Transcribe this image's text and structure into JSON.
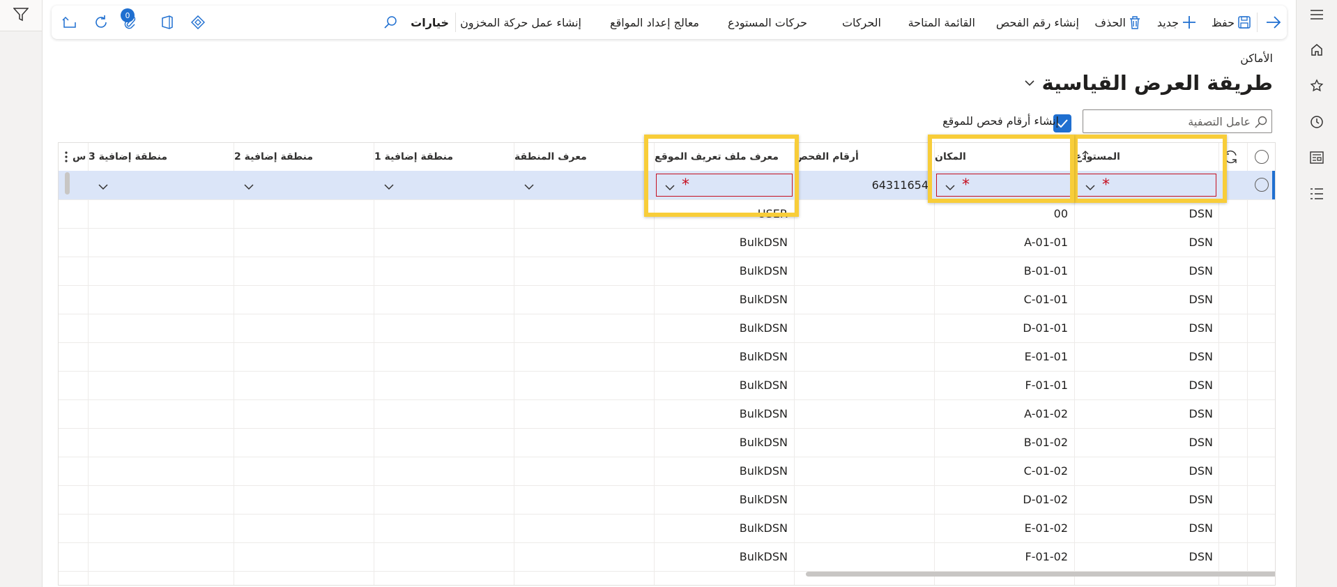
{
  "toolbar": {
    "save_label": "حفظ",
    "new_label": "جديد",
    "delete_label": "الحذف",
    "create_check_digits_label": "إنشاء رقم الفحص",
    "available_list_label": "القائمة المتاحة",
    "transactions_label": "الحركات",
    "warehouse_transactions_label": "حركات المستودع",
    "location_setup_wizard_label": "معالج إعداد المواقع",
    "create_inventory_movement_label": "إنشاء عمل حركة المخزون",
    "options_label": "خيارات",
    "attachments_count": "0"
  },
  "page": {
    "breadcrumb": "الأماكن",
    "view_title": "طريقة العرض القياسية"
  },
  "filter": {
    "placeholder": "عامل التصفية",
    "create_check_digits_checkbox_label": "إنشاء أرقام فحص للموقع",
    "create_check_digits_checked": true
  },
  "grid": {
    "columns": {
      "warehouse": "المستودع",
      "location": "المكان",
      "check_digits": "أرقام الفحص",
      "location_profile": "معرف ملف تعريف الموقع",
      "zone": "معرف المنطقة",
      "extra_zone_1": "منطقة إضافية 1",
      "extra_zone_2": "منطقة إضافية 2",
      "extra_zone_3": "منطقة إضافية 3",
      "overflow": "س"
    },
    "new_row": {
      "check_digits": "64311654"
    },
    "rows": [
      {
        "warehouse": "DSN",
        "location": "00",
        "profile": "USER"
      },
      {
        "warehouse": "DSN",
        "location": "A-01-01",
        "profile": "BulkDSN"
      },
      {
        "warehouse": "DSN",
        "location": "B-01-01",
        "profile": "BulkDSN"
      },
      {
        "warehouse": "DSN",
        "location": "C-01-01",
        "profile": "BulkDSN"
      },
      {
        "warehouse": "DSN",
        "location": "D-01-01",
        "profile": "BulkDSN"
      },
      {
        "warehouse": "DSN",
        "location": "E-01-01",
        "profile": "BulkDSN"
      },
      {
        "warehouse": "DSN",
        "location": "F-01-01",
        "profile": "BulkDSN"
      },
      {
        "warehouse": "DSN",
        "location": "A-01-02",
        "profile": "BulkDSN"
      },
      {
        "warehouse": "DSN",
        "location": "B-01-02",
        "profile": "BulkDSN"
      },
      {
        "warehouse": "DSN",
        "location": "C-01-02",
        "profile": "BulkDSN"
      },
      {
        "warehouse": "DSN",
        "location": "D-01-02",
        "profile": "BulkDSN"
      },
      {
        "warehouse": "DSN",
        "location": "E-01-02",
        "profile": "BulkDSN"
      },
      {
        "warehouse": "DSN",
        "location": "F-01-02",
        "profile": "BulkDSN"
      }
    ]
  },
  "colors": {
    "accent": "#1f6fd0",
    "selected_row": "#dbe5f8",
    "required": "#c50f1f",
    "highlight": "#f8cd39"
  }
}
